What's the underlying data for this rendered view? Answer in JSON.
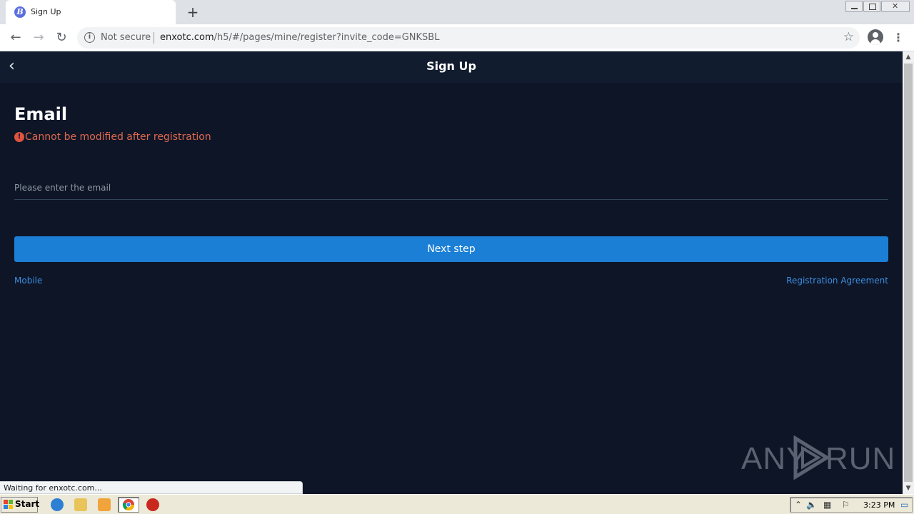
{
  "browser": {
    "tab_title": "Sign Up",
    "tab_favicon_letter": "B",
    "close_glyph": "✕",
    "newtab_glyph": "+",
    "security_label": "Not secure",
    "url_host": "enxotc.com",
    "url_path": "/h5/#/pages/mine/register?invite_code=GNKSBL",
    "status_text": "Waiting for enxotc.com..."
  },
  "icons": {
    "back": "←",
    "forward": "→",
    "reload": "↻",
    "info": "i",
    "star": "☆",
    "menu": "⋮",
    "page_back": "‹",
    "warning": "!",
    "scroll_up": "▲",
    "scroll_down": "▼"
  },
  "page": {
    "header_title": "Sign Up",
    "field_title": "Email",
    "warning_text": "Cannot be modified after registration",
    "email_placeholder": "Please enter the email",
    "email_value": "",
    "next_button_label": "Next step",
    "mobile_link": "Mobile",
    "agreement_link": "Registration Agreement"
  },
  "watermark": {
    "left_text": "ANY",
    "right_text": "RUN"
  },
  "taskbar": {
    "start_label": "Start",
    "clock": "3:23 PM"
  },
  "colors": {
    "page_bg": "#0e1526",
    "header_bg": "#111d2e",
    "accent_blue": "#1b7fd6",
    "link_blue": "#3a8ee0",
    "warning_red": "#e0694f"
  }
}
